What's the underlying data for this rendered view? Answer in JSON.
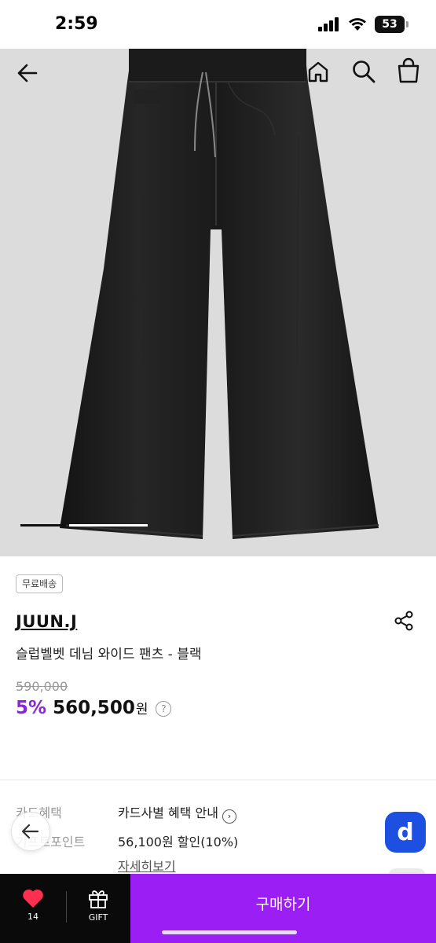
{
  "status_bar": {
    "time": "2:59",
    "battery": "53"
  },
  "product": {
    "badge": "무료배송",
    "brand": "JUUN.J",
    "name": "슬럽벨벳 데님 와이드 팬츠 - 블랙",
    "original_price": "590,000",
    "discount_rate": "5%",
    "sale_price": "560,500",
    "price_unit": "원",
    "help_glyph": "?"
  },
  "carousel": {
    "current_fraction": 0.33
  },
  "benefits": [
    {
      "label": "카드혜택",
      "value": "카드사별 혜택 안내"
    },
    {
      "label": "기프트포인트",
      "value": "56,100원 할인(10%)"
    }
  ],
  "detail_link": "자세히보기",
  "floating": {
    "d_button_label": "d"
  },
  "bottom_bar": {
    "like_count": "14",
    "gift_label": "GIFT",
    "buy_label": "구매하기"
  },
  "colors": {
    "accent_purple": "#9b1ff4",
    "discount_purple": "#8a25d9",
    "d_button_blue": "#1d4fe0",
    "like_red": "#ff2f4f",
    "hero_bg": "#dcdcdc"
  }
}
